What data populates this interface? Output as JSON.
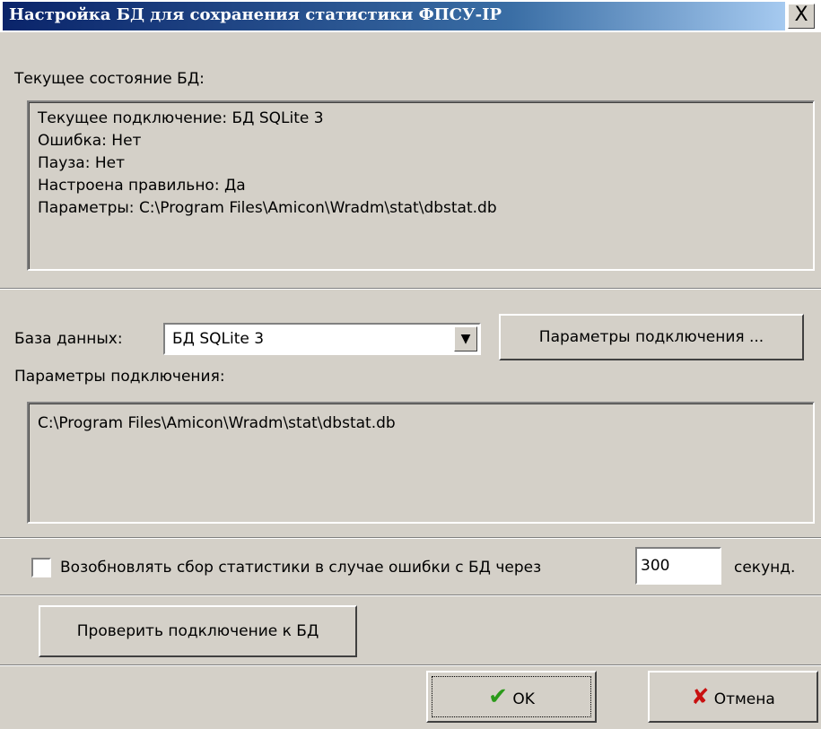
{
  "window": {
    "title": "Настройка БД для сохранения статистики ФПСУ-IP",
    "close_glyph": "X"
  },
  "status": {
    "heading": "Текущее состояние БД:",
    "lines": [
      "Текущее подключение: БД SQLite 3",
      "Ошибка: Нет",
      "Пауза: Нет",
      "Настроена правильно: Да",
      "Параметры: C:\\Program Files\\Amicon\\Wradm\\stat\\dbstat.db"
    ]
  },
  "database": {
    "label": "База данных:",
    "selected": "БД SQLite 3",
    "params_button": "Параметры подключения ...",
    "params_label": "Параметры подключения:",
    "params_value": "C:\\Program Files\\Amicon\\Wradm\\stat\\dbstat.db"
  },
  "resume": {
    "checked": false,
    "label": "Возобновлять сбор статистики  в случае ошибки с БД через",
    "seconds_value": "300",
    "unit": "секунд."
  },
  "test_button": "Проверить подключение к БД",
  "footer": {
    "ok_label": "OK",
    "cancel_label": "Отмена"
  },
  "icons": {
    "ok": "check-icon",
    "cancel": "x-icon",
    "close": "close-icon"
  }
}
